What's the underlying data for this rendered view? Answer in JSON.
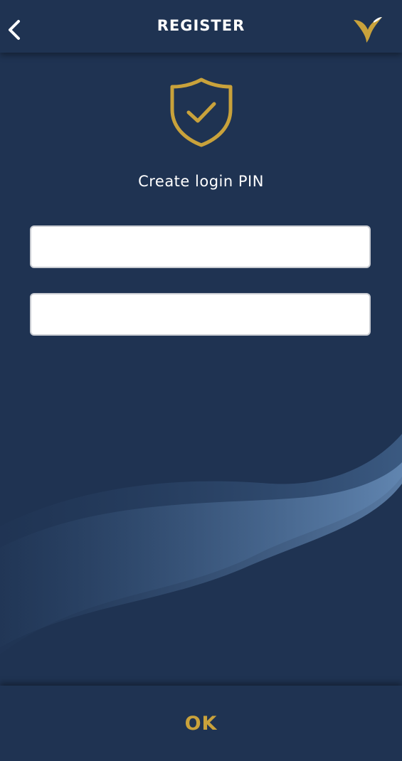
{
  "header": {
    "title": "REGISTER",
    "back_icon": "chevron-left-icon",
    "logo_icon": "bird-logo-icon"
  },
  "main": {
    "shield_icon": "shield-check-icon",
    "prompt": "Create login PIN",
    "pin_input": {
      "value": "",
      "placeholder": ""
    },
    "confirm_pin_input": {
      "value": "",
      "placeholder": ""
    }
  },
  "footer": {
    "ok_label": "OK"
  },
  "colors": {
    "background": "#1f3352",
    "accent_gold": "#c9a23b",
    "text_white": "#ffffff",
    "input_bg": "#ffffff"
  }
}
